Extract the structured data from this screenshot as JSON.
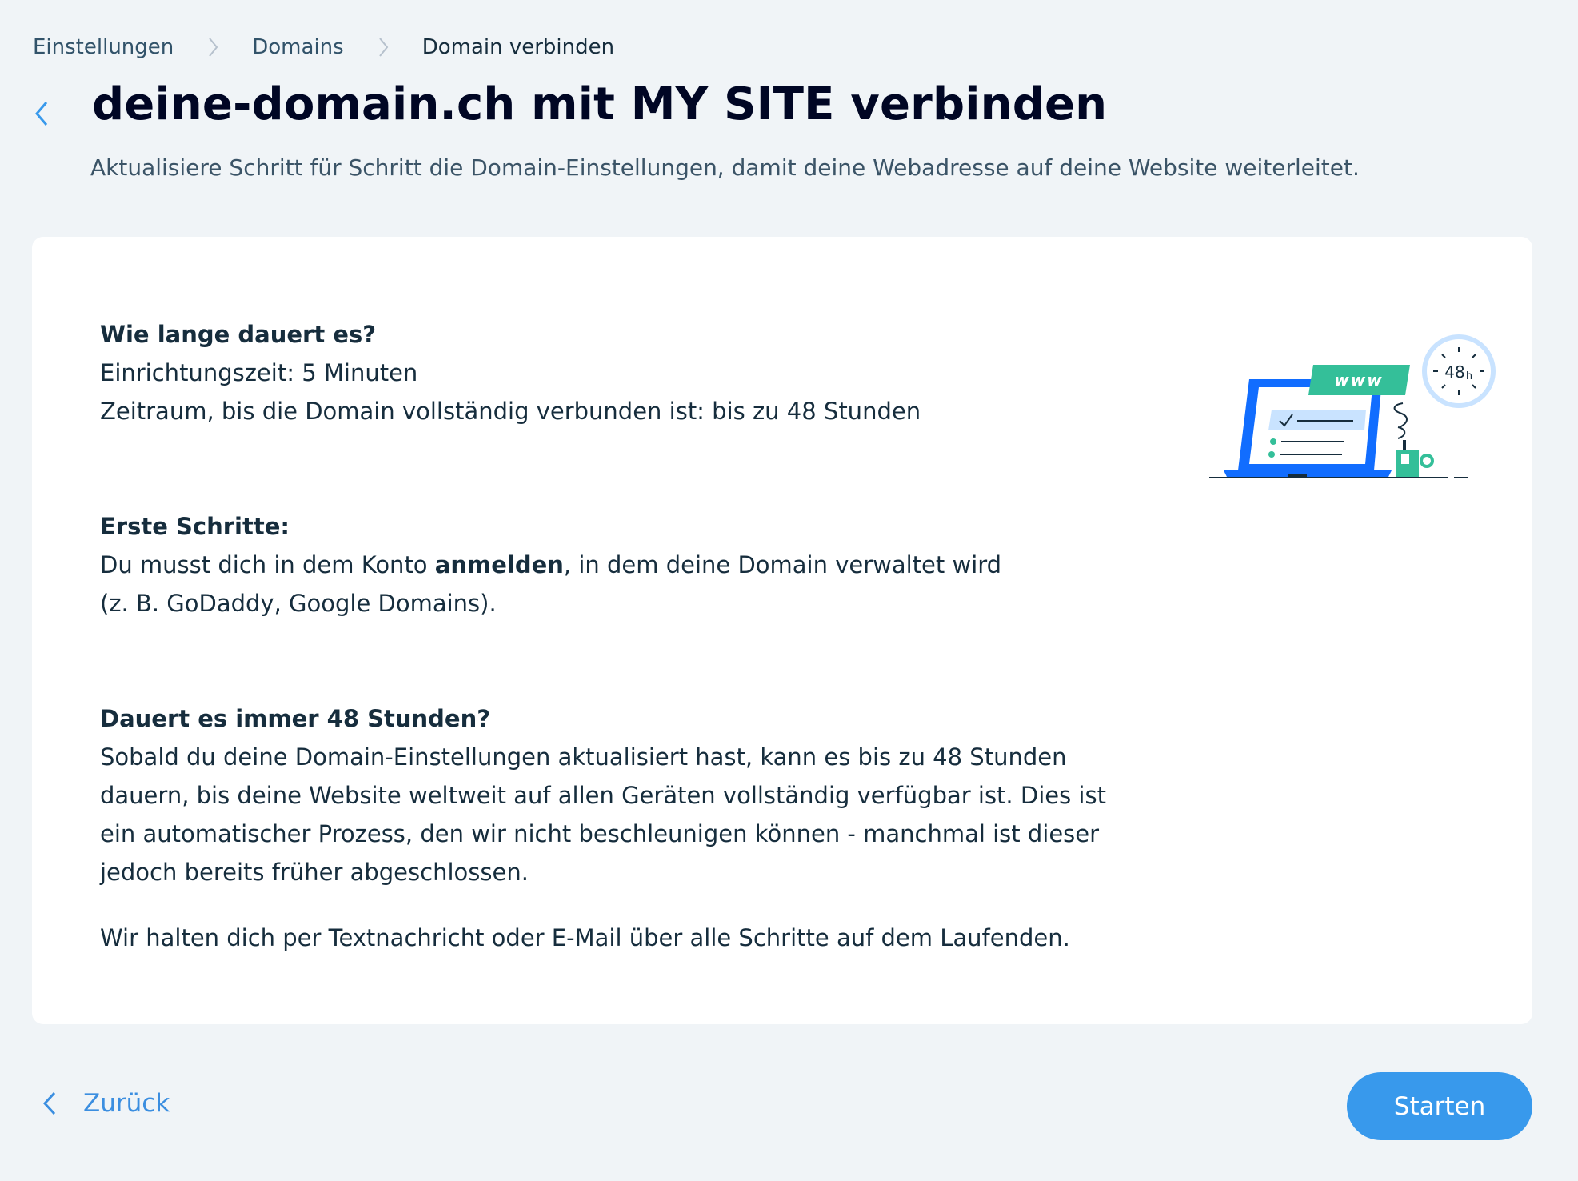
{
  "breadcrumb": {
    "items": [
      {
        "label": "Einstellungen"
      },
      {
        "label": "Domains"
      },
      {
        "label": "Domain verbinden"
      }
    ]
  },
  "header": {
    "title": "deine-domain.ch mit MY SITE verbinden",
    "subtitle": "Aktualisiere Schritt für Schritt die Domain-Einstellungen, damit deine Webadresse auf deine Website weiterleitet."
  },
  "content": {
    "duration": {
      "heading": "Wie lange dauert es?",
      "setup_time": "Einrichtungszeit: 5 Minuten",
      "period": "Zeitraum, bis die Domain vollständig verbunden ist: bis zu 48 Stunden"
    },
    "first_steps": {
      "heading": "Erste Schritte:",
      "text_before": "Du musst dich in dem Konto ",
      "text_bold": "anmelden",
      "text_after": ", in dem deine Domain verwaltet wird",
      "text_line2": "(z. B. GoDaddy, Google Domains)."
    },
    "always_48": {
      "heading": "Dauert es immer 48 Stunden?",
      "lines": [
        "Sobald du deine Domain-Einstellungen aktualisiert hast, kann es bis zu 48 Stunden",
        "dauern, bis deine Website weltweit auf allen Geräten vollständig verfügbar ist. Dies ist",
        "ein automatischer Prozess, den wir nicht beschleunigen können - manchmal ist dieser",
        "jedoch bereits früher abgeschlossen."
      ]
    },
    "notify": "Wir halten dich per Textnachricht oder E-Mail über alle Schritte auf dem Laufenden."
  },
  "illustration": {
    "www_label": "www",
    "clock_label": "48",
    "clock_unit": "h"
  },
  "footer": {
    "back_label": "Zurück",
    "start_label": "Starten"
  },
  "colors": {
    "background": "#f0f4f7",
    "card": "#ffffff",
    "accent_blue": "#3899ec",
    "link_blue": "#3b8ee0",
    "laptop_blue": "#116dff",
    "green": "#34bf99",
    "text_dark": "#162d3d"
  }
}
